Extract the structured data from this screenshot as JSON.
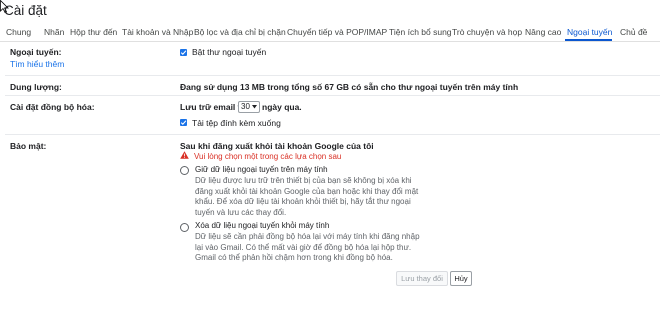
{
  "page": {
    "title": "Cài đặt"
  },
  "tabs": [
    {
      "label": "Chung"
    },
    {
      "label": "Nhãn"
    },
    {
      "label": "Hộp thư đến"
    },
    {
      "label": "Tài khoản và Nhập"
    },
    {
      "label": "Bộ lọc và địa chỉ bị chặn"
    },
    {
      "label": "Chuyển tiếp và POP/IMAP"
    },
    {
      "label": "Tiện ích bổ sung"
    },
    {
      "label": "Trò chuyện và họp"
    },
    {
      "label": "Nâng cao"
    },
    {
      "label": "Ngoại tuyến"
    },
    {
      "label": "Chủ đề"
    }
  ],
  "active_tab": "Ngoại tuyến",
  "offline": {
    "label": "Ngoại tuyến:",
    "learn_more": "Tìm hiểu thêm",
    "enable_label": "Bật thư ngoại tuyến",
    "enable_checked": true
  },
  "storage": {
    "label": "Dung lượng:",
    "text": "Đang sử dụng 13 MB trong tổng số 67 GB có sẵn cho thư ngoại tuyến trên máy tính"
  },
  "sync": {
    "label": "Cài đặt đồng bộ hóa:",
    "prefix": "Lưu trữ email từ",
    "days_value": "30",
    "suffix": "ngày qua.",
    "attachments_label": "Tải tệp đính kèm xuống",
    "attachments_checked": true
  },
  "security": {
    "label": "Bảo mật:",
    "heading": "Sau khi đăng xuất khỏi tài khoản Google của tôi",
    "warning": "Vui lòng chọn một trong các lựa chọn sau",
    "options": [
      {
        "title": "Giữ dữ liệu ngoại tuyến trên máy tính",
        "lines": [
          "Dữ liệu được lưu trữ trên thiết bị của bạn sẽ không bị xóa khi",
          "đăng xuất khỏi tài khoản Google của bạn hoặc khi thay đổi mật",
          "khẩu. Để xóa dữ liệu tài khoản khỏi thiết bị, hãy tắt thư ngoại",
          "tuyến và lưu các thay đổi."
        ]
      },
      {
        "title": "Xóa dữ liệu ngoại tuyến khỏi máy tính",
        "lines": [
          "Dữ liệu sẽ cần phải đồng bộ hóa lại với máy tính khi đăng nhập",
          "lại vào Gmail. Có thể mất vài giờ để đồng bộ hóa lại hộp thư.",
          "Gmail có thể phản hồi chậm hơn trong khi đồng bộ hóa."
        ]
      }
    ]
  },
  "buttons": {
    "save": "Lưu thay đổi",
    "cancel": "Hủy"
  },
  "colors": {
    "accent": "#0b57d0",
    "checkbox": "#1a73e8",
    "warning": "#d93025"
  }
}
